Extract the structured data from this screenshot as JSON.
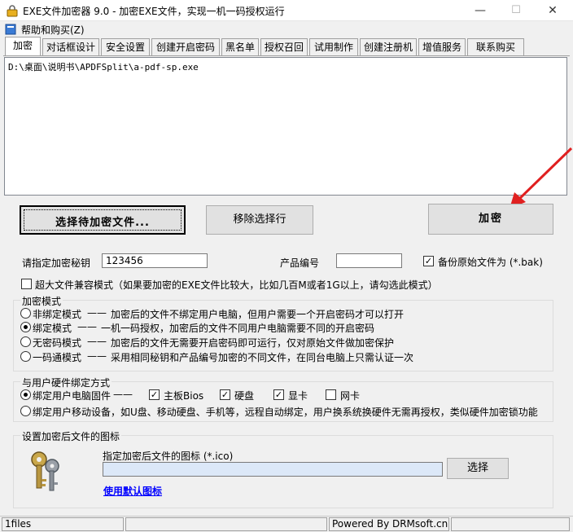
{
  "window": {
    "title": "EXE文件加密器 9.0 - 加密EXE文件，实现一机一码授权运行",
    "minimize": "—",
    "maximize": "☐",
    "close": "✕"
  },
  "menu": {
    "help": "帮助和购买(Z)"
  },
  "tabs": [
    "加密",
    "对话框设计",
    "安全设置",
    "创建开启密码",
    "黑名单",
    "授权召回",
    "试用制作",
    "创建注册机",
    "增值服务",
    "联系购买"
  ],
  "file_list": {
    "path": "D:\\桌面\\说明书\\APDFSplit\\a-pdf-sp.exe"
  },
  "buttons": {
    "select_files": "选择待加密文件...",
    "remove_row": "移除选择行",
    "encrypt": "加密",
    "browse": "选择"
  },
  "key": {
    "label": "请指定加密秘钥",
    "value": "123456"
  },
  "product": {
    "label": "产品编号",
    "value": ""
  },
  "backup": {
    "label": "备份原始文件为 (*.bak)",
    "checked": true
  },
  "large_file": {
    "label": "超大文件兼容模式（如果要加密的EXE文件比较大，比如几百M或者1G以上，请勾选此模式）",
    "checked": false
  },
  "mode_group": {
    "title": "加密模式",
    "options": [
      {
        "name": "非绑定模式",
        "desc": "加密后的文件不绑定用户电脑，但用户需要一个开启密码才可以打开",
        "selected": false
      },
      {
        "name": "绑定模式",
        "desc": "一机一码授权，加密后的文件不同用户电脑需要不同的开启密码",
        "selected": true
      },
      {
        "name": "无密码模式",
        "desc": "加密后的文件无需要开启密码即可运行，仅对原始文件做加密保护",
        "selected": false
      },
      {
        "name": "一码通模式",
        "desc": "采用相同秘钥和产品编号加密的不同文件，在同台电脑上只需认证一次",
        "selected": false
      }
    ],
    "dash": "——"
  },
  "hardware_group": {
    "title": "与用户硬件绑定方式",
    "firmware_label": "绑定用户电脑固件",
    "dash": "——",
    "items": [
      {
        "label": "主板Bios",
        "checked": true
      },
      {
        "label": "硬盘",
        "checked": true
      },
      {
        "label": "显卡",
        "checked": true
      },
      {
        "label": "网卡",
        "checked": false
      }
    ],
    "mobile_label": "绑定用户移动设备，如U盘、移动硬盘、手机等，远程自动绑定，用户换系统换硬件无需再授权，类似硬件加密锁功能"
  },
  "icon_group": {
    "title": "设置加密后文件的图标",
    "prompt": "指定加密后文件的图标 (*.ico)",
    "path": "",
    "default_link": "使用默认图标"
  },
  "status": {
    "files": "1files",
    "middle": "",
    "powered": "Powered By DRMsoft.cn",
    "right": ""
  },
  "colors": {
    "arrow": "#e02020",
    "input_blue": "#dce8f8"
  }
}
